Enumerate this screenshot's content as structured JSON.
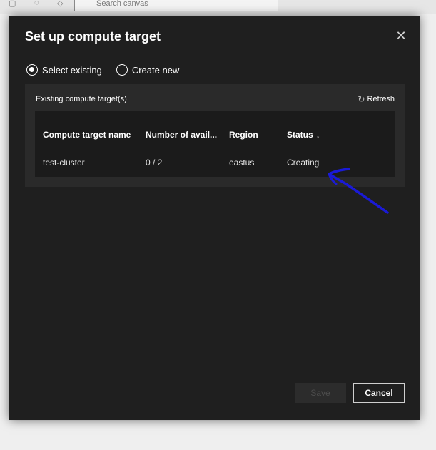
{
  "background": {
    "search_placeholder": "Search canvas"
  },
  "dialog": {
    "title": "Set up compute target",
    "close_icon": "close-icon",
    "options": [
      {
        "label": "Select existing",
        "checked": true
      },
      {
        "label": "Create new",
        "checked": false
      }
    ],
    "panel_title": "Existing compute target(s)",
    "refresh_label": "Refresh",
    "table": {
      "columns": [
        "Compute target name",
        "Number of avail...",
        "Region",
        "Status"
      ],
      "sort_icon": "↓",
      "rows": [
        {
          "name": "test-cluster",
          "nodes": "0 / 2",
          "region": "eastus",
          "status": "Creating"
        }
      ]
    },
    "buttons": {
      "save": "Save",
      "cancel": "Cancel"
    }
  },
  "colors": {
    "dialog_bg": "#1f1f1f",
    "annotation": "#1a1ad6"
  }
}
